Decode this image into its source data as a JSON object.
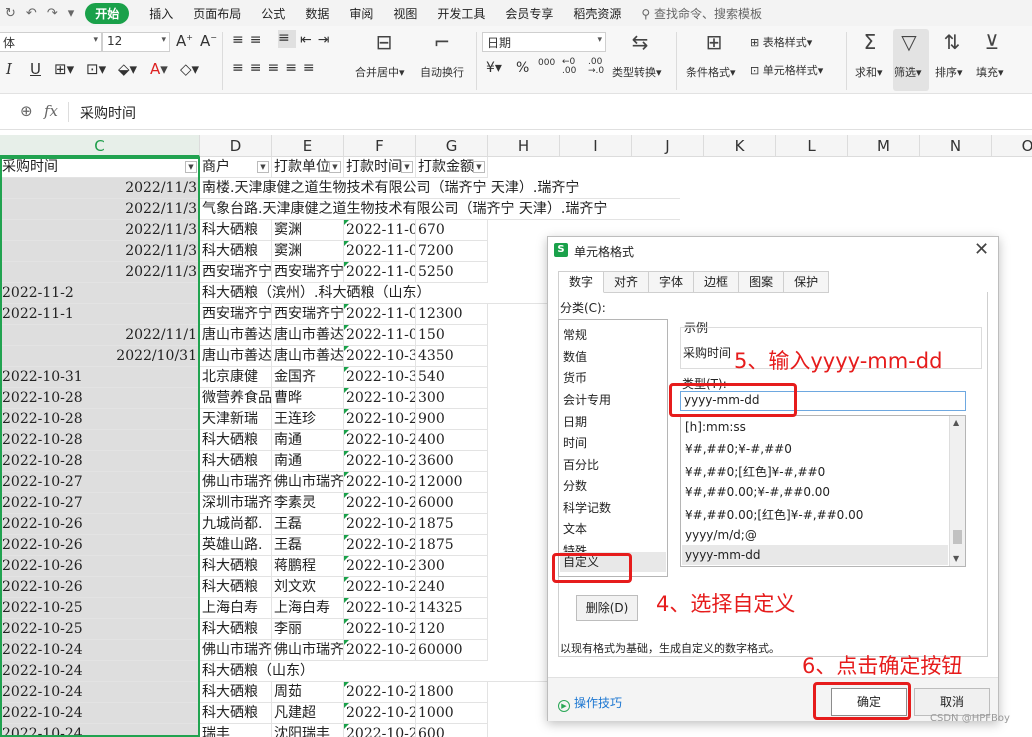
{
  "menubar": {
    "start": "开始",
    "items": [
      "插入",
      "页面布局",
      "公式",
      "数据",
      "审阅",
      "视图",
      "开发工具",
      "会员专享",
      "稻壳资源"
    ],
    "search_placeholder": "查找命令、搜索模板"
  },
  "ribbon": {
    "font_name": "体",
    "font_size": "12",
    "merge_center": "合并居中",
    "wrap": "自动换行",
    "number_format": "日期",
    "type_convert": "类型转换",
    "cond_format": "条件格式",
    "table_style": "表格样式",
    "cell_style": "单元格样式",
    "sum": "求和",
    "filter": "筛选",
    "sort": "排序",
    "fill": "填充",
    "currency_symbol": "¥",
    "percent_symbol": "%",
    "thousands_symbol": "000"
  },
  "formula_bar": {
    "content": "采购时间"
  },
  "columns": [
    "C",
    "D",
    "E",
    "F",
    "G",
    "H",
    "I",
    "J",
    "K",
    "L",
    "M",
    "N",
    "O"
  ],
  "sheet": {
    "header": {
      "c": "采购时间",
      "d": "商户",
      "e": "打款单位",
      "f": "打款时间",
      "g": "打款金额"
    },
    "rows": [
      {
        "c": "2022/11/3",
        "align": "right",
        "d_spill": "南楼.天津康健之道生物技术有限公司（瑞齐宁 天津）.瑞齐宁"
      },
      {
        "c": "2022/11/3",
        "align": "right",
        "d_spill": "气象台路.天津康健之道生物技术有限公司（瑞齐宁 天津）.瑞齐宁"
      },
      {
        "c": "2022/11/3",
        "align": "right",
        "d": "科大硒粮",
        "e": "窦渊",
        "f": "2022-11-0",
        "g": "670"
      },
      {
        "c": "2022/11/3",
        "align": "right",
        "d": "科大硒粮",
        "e": "窦渊",
        "f": "2022-11-0",
        "g": "7200"
      },
      {
        "c": "2022/11/3",
        "align": "right",
        "d": "西安瑞齐宁",
        "e": "西安瑞齐宁",
        "f": "2022-11-0",
        "g": "5250"
      },
      {
        "c": "2022-11-2",
        "align": "left",
        "d_spill": "科大硒粮（滨州）.科大硒粮（山东）"
      },
      {
        "c": "2022-11-1",
        "align": "left",
        "d": "西安瑞齐宁",
        "e": "西安瑞齐宁",
        "f": "2022-11-0",
        "g": "12300"
      },
      {
        "c": "2022/11/1",
        "align": "right",
        "d": "唐山市善达",
        "e": "唐山市善达",
        "f": "2022-11-0",
        "g": "150"
      },
      {
        "c": "2022/10/31",
        "align": "right",
        "d": "唐山市善达",
        "e": "唐山市善达",
        "f": "2022-10-3",
        "g": "4350"
      },
      {
        "c": "2022-10-31",
        "align": "left",
        "d": "北京康健",
        "e": "金国齐",
        "f": "2022-10-3",
        "g": "540"
      },
      {
        "c": "2022-10-28",
        "align": "left",
        "d": "微营养食品",
        "e": "曹晔",
        "f": "2022-10-2",
        "g": "300"
      },
      {
        "c": "2022-10-28",
        "align": "left",
        "d": "天津新瑞",
        "e": "王连珍",
        "f": "2022-10-2",
        "g": "900"
      },
      {
        "c": "2022-10-28",
        "align": "left",
        "d": "科大硒粮",
        "e": "南通",
        "f": "2022-10-2",
        "g": "400"
      },
      {
        "c": "2022-10-28",
        "align": "left",
        "d": "科大硒粮",
        "e": "南通",
        "f": "2022-10-2",
        "g": "3600"
      },
      {
        "c": "2022-10-27",
        "align": "left",
        "d": "佛山市瑞齐",
        "e": "佛山市瑞齐",
        "f": "2022-10-2",
        "g": "12000"
      },
      {
        "c": "2022-10-27",
        "align": "left",
        "d": "深圳市瑞齐",
        "e": "李素灵",
        "f": "2022-10-2",
        "g": "6000"
      },
      {
        "c": "2022-10-26",
        "align": "left",
        "d": "九城尚都.",
        "e": "王磊",
        "f": "2022-10-2",
        "g": "1875"
      },
      {
        "c": "2022-10-26",
        "align": "left",
        "d": "英雄山路.",
        "e": "王磊",
        "f": "2022-10-2",
        "g": "1875"
      },
      {
        "c": "2022-10-26",
        "align": "left",
        "d": "科大硒粮",
        "e": "蒋鹏程",
        "f": "2022-10-2",
        "g": "300"
      },
      {
        "c": "2022-10-26",
        "align": "left",
        "d": "科大硒粮",
        "e": "刘文欢",
        "f": "2022-10-2",
        "g": "240"
      },
      {
        "c": "2022-10-25",
        "align": "left",
        "d": "上海白寿",
        "e": "上海白寿",
        "f": "2022-10-2",
        "g": "14325"
      },
      {
        "c": "2022-10-25",
        "align": "left",
        "d": "科大硒粮",
        "e": "李丽",
        "f": "2022-10-2",
        "g": "120"
      },
      {
        "c": "2022-10-24",
        "align": "left",
        "d": "佛山市瑞齐",
        "e": "佛山市瑞齐",
        "f": "2022-10-2",
        "g": "60000"
      },
      {
        "c": "2022-10-24",
        "align": "left",
        "d_spill": "科大硒粮（山东）"
      },
      {
        "c": "2022-10-24",
        "align": "left",
        "d": "科大硒粮",
        "e": "周茹",
        "f": "2022-10-2",
        "g": "1800"
      },
      {
        "c": "2022-10-24",
        "align": "left",
        "d": "科大硒粮",
        "e": "凡建超",
        "f": "2022-10-2",
        "g": "1000"
      },
      {
        "c": "2022-10-24",
        "align": "left",
        "d": "瑞丰",
        "e": "沈阳瑞丰",
        "f": "2022-10-2",
        "g": "600"
      }
    ]
  },
  "dialog": {
    "title": "单元格格式",
    "tabs": [
      "数字",
      "对齐",
      "字体",
      "边框",
      "图案",
      "保护"
    ],
    "category_label": "分类(C):",
    "categories": [
      "常规",
      "数值",
      "货币",
      "会计专用",
      "日期",
      "时间",
      "百分比",
      "分数",
      "科学记数",
      "文本",
      "特殊",
      "自定义"
    ],
    "selected_category": "自定义",
    "sample_label": "示例",
    "sample_value": "采购时间",
    "type_label": "类型(T):",
    "type_value": "yyyy-mm-dd",
    "format_list": [
      "[h]:mm:ss",
      "¥#,##0;¥-#,##0",
      "¥#,##0;[红色]¥-#,##0",
      "¥#,##0.00;¥-#,##0.00",
      "¥#,##0.00;[红色]¥-#,##0.00",
      "yyyy/m/d;@",
      "yyyy-mm-dd"
    ],
    "delete_button": "删除(D)",
    "description": "以现有格式为基础，生成自定义的数字格式。",
    "tips": "操作技巧",
    "ok": "确定",
    "cancel": "取消"
  },
  "annotations": {
    "step4": "4、选择自定义",
    "step5": "5、输入yyyy-mm-dd",
    "step6": "6、点击确定按钮"
  },
  "watermark": "CSDN @HPFBoy"
}
